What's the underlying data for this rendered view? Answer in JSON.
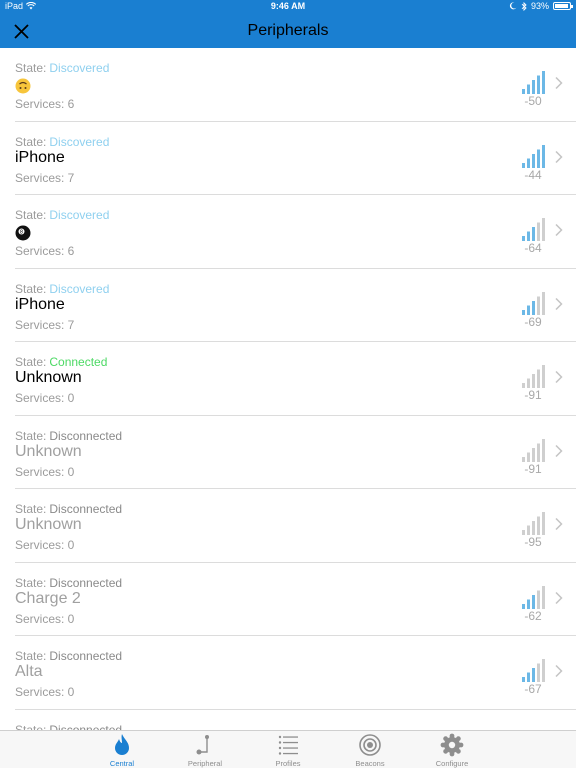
{
  "statusbar": {
    "device": "iPad",
    "time": "9:46 AM",
    "battery": "93%"
  },
  "nav": {
    "title": "Peripherals"
  },
  "colors": {
    "accent": "#1a7fd1",
    "discovered": "#8fd0ef",
    "connected": "#4cd964"
  },
  "state_label": "State:",
  "services_label": "Services:",
  "peripherals": [
    {
      "state": "Discovered",
      "state_kind": "discovered",
      "name": "",
      "name_icon": "upside-down-face-emoji-icon",
      "services": "6",
      "rssi": "-50",
      "bars": 5,
      "dim": false
    },
    {
      "state": "Discovered",
      "state_kind": "discovered",
      "name": "iPhone",
      "services": "7",
      "rssi": "-44",
      "bars": 5,
      "dim": false
    },
    {
      "state": "Discovered",
      "state_kind": "discovered",
      "name": "",
      "name_icon": "pool-8-ball-emoji-icon",
      "services": "6",
      "rssi": "-64",
      "bars": 3,
      "dim": false
    },
    {
      "state": "Discovered",
      "state_kind": "discovered",
      "name": "iPhone",
      "services": "7",
      "rssi": "-69",
      "bars": 3,
      "dim": false
    },
    {
      "state": "Connected",
      "state_kind": "connected",
      "name": "Unknown",
      "services": "0",
      "rssi": "-91",
      "bars": 0,
      "dim": false
    },
    {
      "state": "Disconnected",
      "state_kind": "disconnected",
      "name": "Unknown",
      "services": "0",
      "rssi": "-91",
      "bars": 0,
      "dim": true
    },
    {
      "state": "Disconnected",
      "state_kind": "disconnected",
      "name": "Unknown",
      "services": "0",
      "rssi": "-95",
      "bars": 0,
      "dim": true
    },
    {
      "state": "Disconnected",
      "state_kind": "disconnected",
      "name": "Charge 2",
      "services": "0",
      "rssi": "-62",
      "bars": 3,
      "dim": true
    },
    {
      "state": "Disconnected",
      "state_kind": "disconnected",
      "name": "Alta",
      "services": "0",
      "rssi": "-67",
      "bars": 3,
      "dim": true
    },
    {
      "state": "Disconnected",
      "state_kind": "disconnected",
      "name": "",
      "services": "",
      "rssi": "",
      "bars": 0,
      "dim": true,
      "partial": true
    }
  ],
  "tabs": [
    {
      "label": "Central",
      "icon": "flame-icon",
      "active": true
    },
    {
      "label": "Peripheral",
      "icon": "peripheral-icon",
      "active": false
    },
    {
      "label": "Profiles",
      "icon": "list-icon",
      "active": false
    },
    {
      "label": "Beacons",
      "icon": "beacon-icon",
      "active": false
    },
    {
      "label": "Configure",
      "icon": "gear-icon",
      "active": false
    }
  ]
}
